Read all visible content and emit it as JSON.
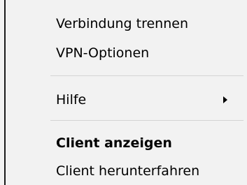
{
  "menu": {
    "items": [
      {
        "label": "Verbindung trennen"
      },
      {
        "label": "VPN-Optionen"
      },
      {
        "label": "Hilfe",
        "icon": "chevron-right-icon"
      },
      {
        "label": "Client anzeigen",
        "bold": true
      },
      {
        "label": "Client herunterfahren"
      }
    ]
  },
  "colors": {
    "menu_background": "#f2f2f2",
    "separator": "#d4d4d4",
    "text": "#000000"
  }
}
